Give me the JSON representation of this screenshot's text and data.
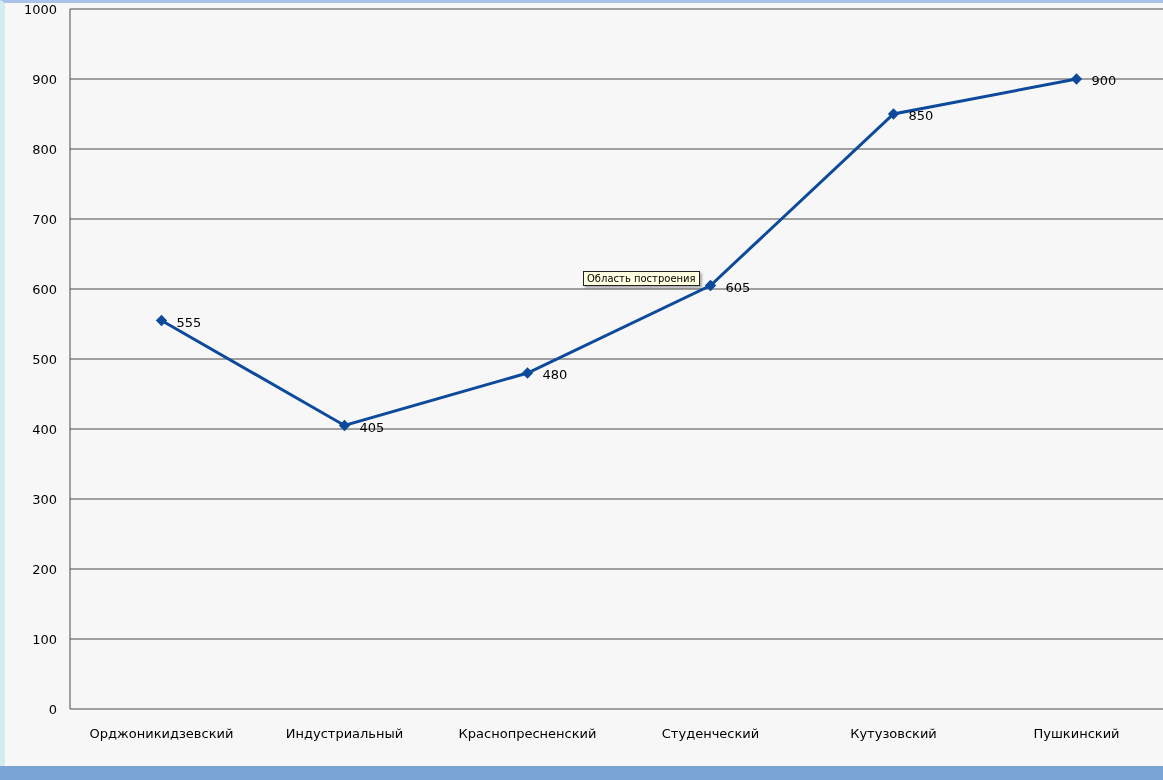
{
  "chart_data": {
    "type": "line",
    "categories": [
      "Орджоникидзевский",
      "Индустриальный",
      "Краснопресненский",
      "Студенческий",
      "Кутузовский",
      "Пушкинский"
    ],
    "series": [
      {
        "color": "#0d4a9c",
        "marker": "diamond",
        "values": [
          555,
          405,
          480,
          605,
          850,
          900
        ]
      }
    ],
    "ylim": [
      0,
      1000
    ],
    "yticks": [
      0,
      100,
      200,
      300,
      400,
      500,
      600,
      700,
      800,
      900,
      1000
    ],
    "grid": true,
    "data_labels": true
  },
  "tooltip": "Область построения"
}
